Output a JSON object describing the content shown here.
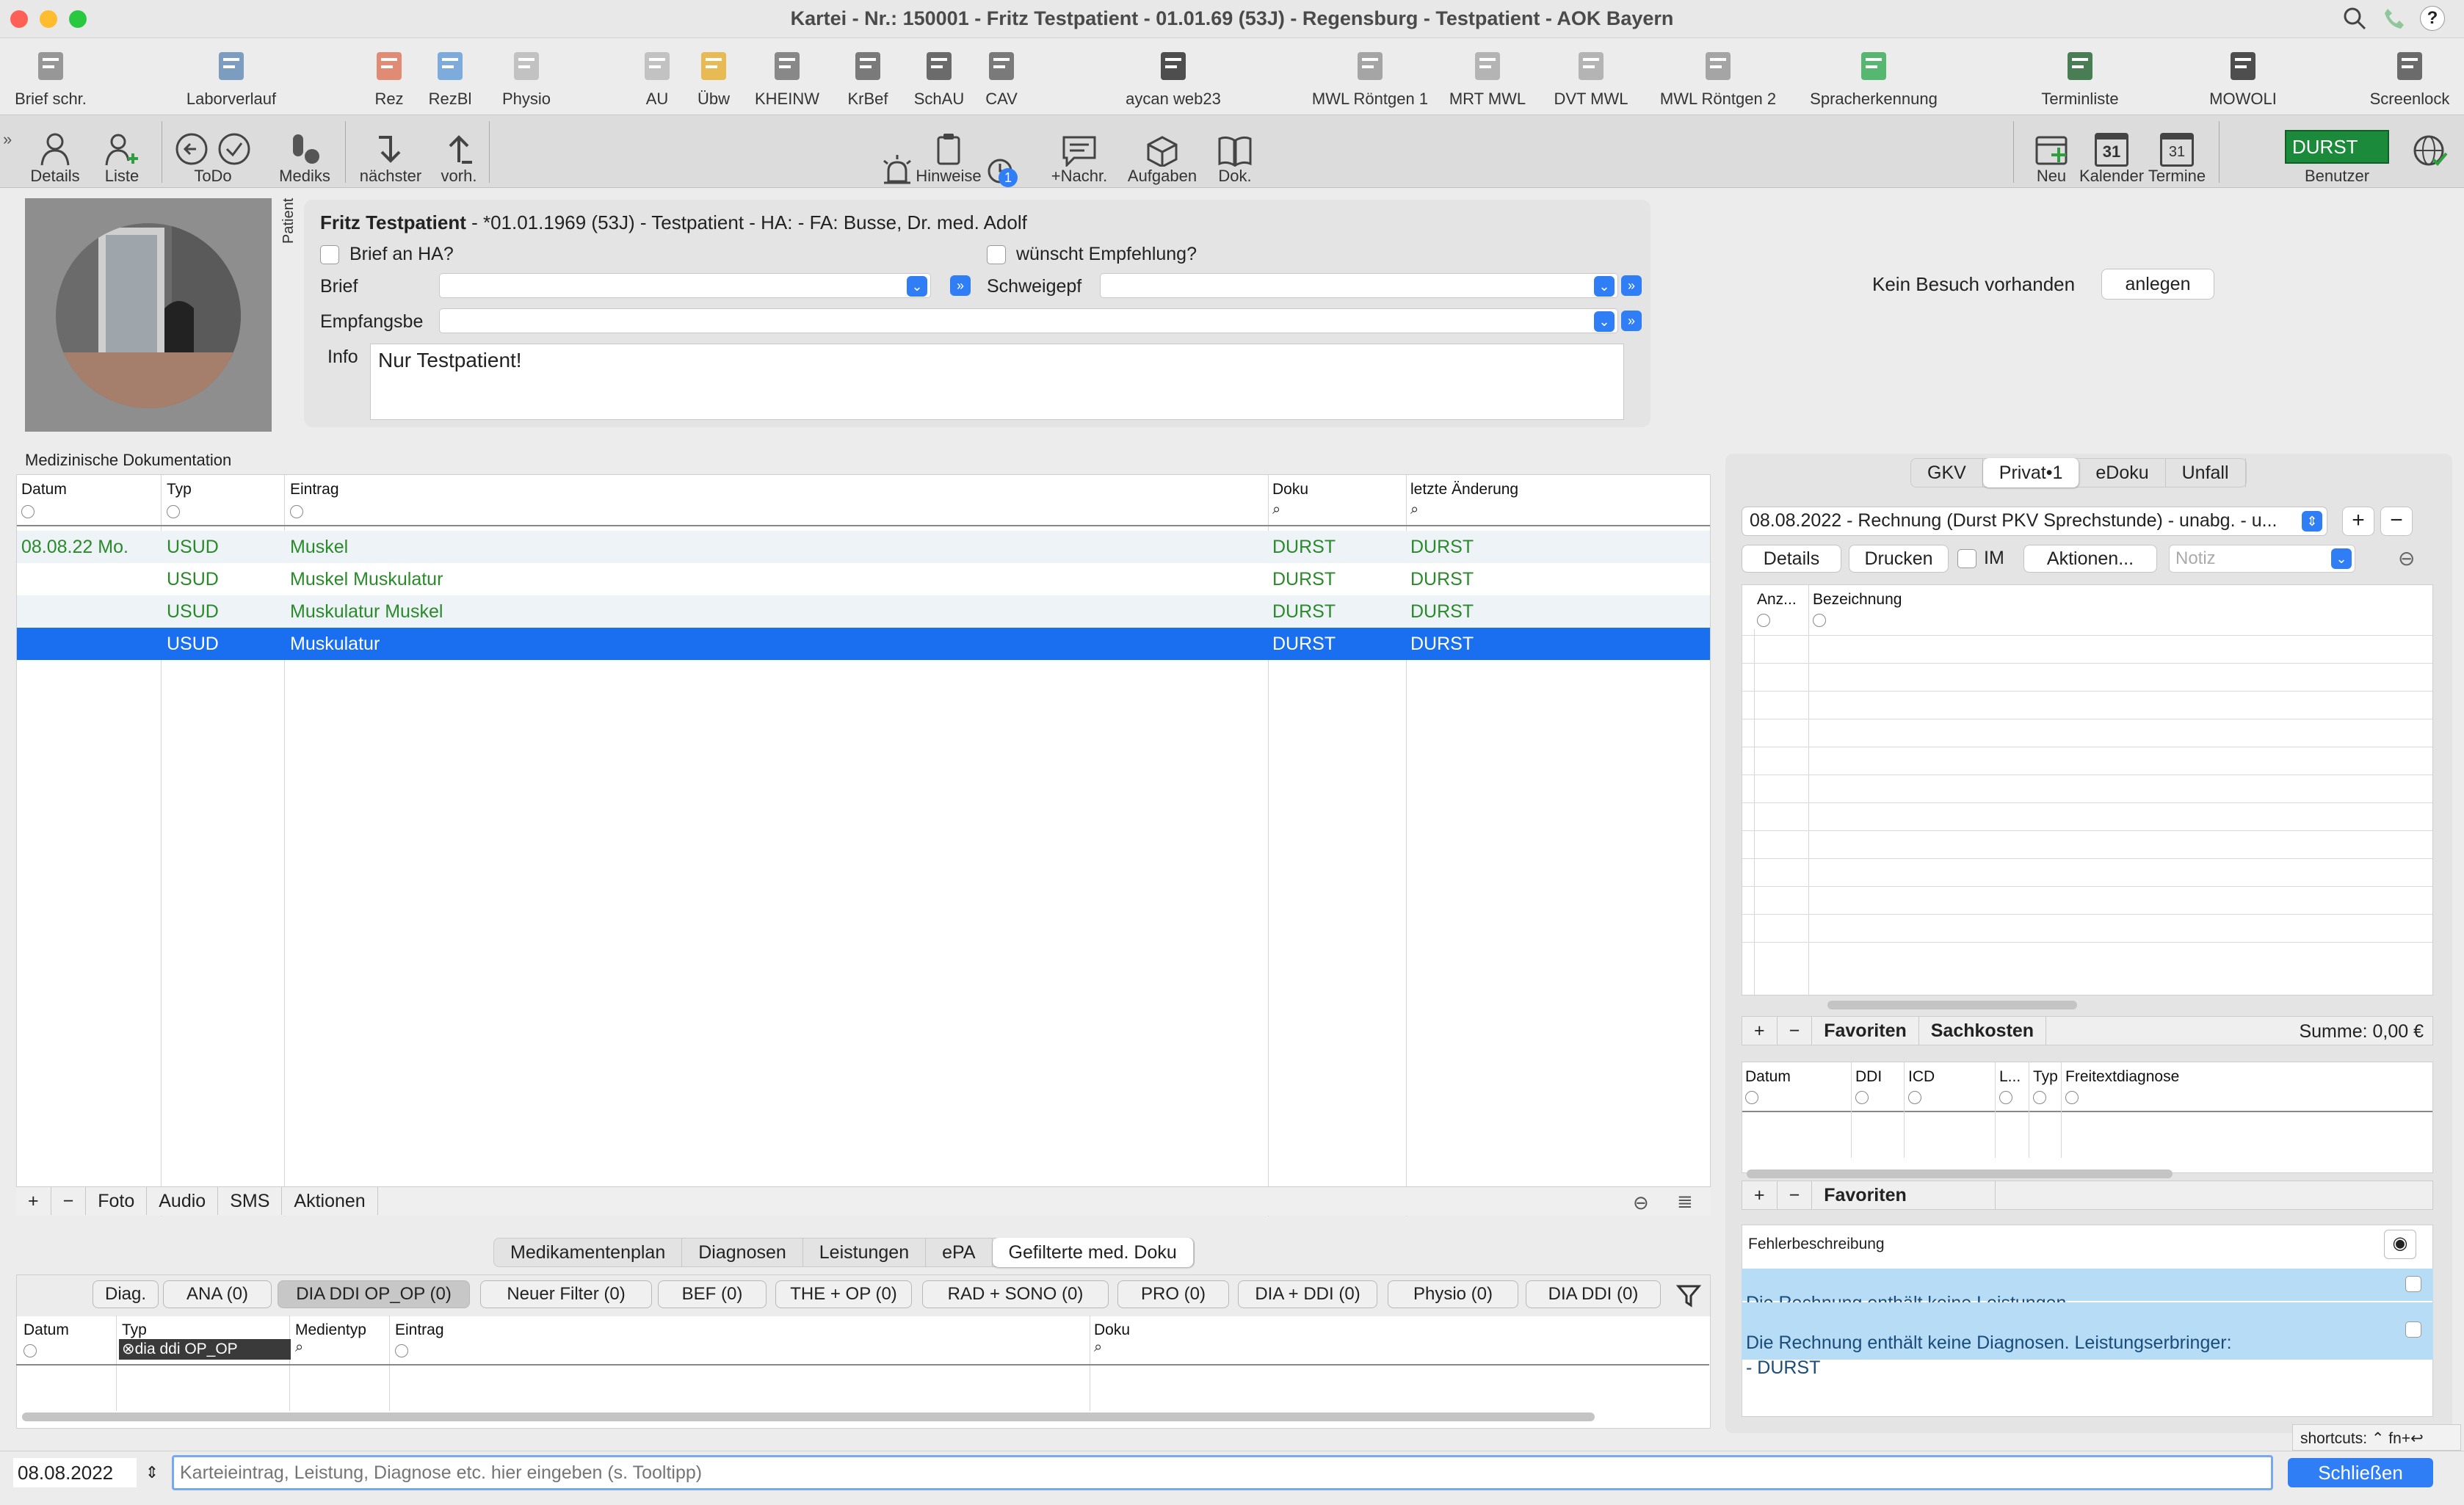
{
  "window": {
    "title": "Kartei - Nr.: 150001 - Fritz Testpatient - 01.01.69 (53J) - Regensburg - Testpatient - AOK Bayern"
  },
  "toolbar1": [
    {
      "label": "Brief schr.",
      "icon": "letter-write-icon"
    },
    {
      "label": "Laborverlauf",
      "icon": "lab-flask-icon"
    },
    {
      "label": "Rez",
      "icon": "prescription-icon"
    },
    {
      "label": "RezBl",
      "icon": "prescription-blue-icon"
    },
    {
      "label": "Physio",
      "icon": "physio-form-icon"
    },
    {
      "label": "AU",
      "icon": "au-form-icon"
    },
    {
      "label": "Übw",
      "icon": "referral-icon"
    },
    {
      "label": "KHEINW",
      "icon": "hospital-icon"
    },
    {
      "label": "KrBef",
      "icon": "ambulance-icon"
    },
    {
      "label": "SchAU",
      "icon": "school-form-icon"
    },
    {
      "label": "CAV",
      "icon": "cav-icon"
    },
    {
      "label": "aycan web23",
      "icon": "aycan-web-icon"
    },
    {
      "label": "MWL Röntgen 1",
      "icon": "xray-device-icon"
    },
    {
      "label": "MRT MWL",
      "icon": "mrt-device-icon"
    },
    {
      "label": "DVT MWL",
      "icon": "dvt-device-icon"
    },
    {
      "label": "MWL Röntgen 2",
      "icon": "xray-device-2-icon"
    },
    {
      "label": "Spracherkennung",
      "icon": "microphone-icon"
    },
    {
      "label": "Terminliste",
      "icon": "appointment-list-icon"
    },
    {
      "label": "MOWOLI",
      "icon": "mowoli-icon"
    },
    {
      "label": "Screenlock",
      "icon": "screenlock-icon"
    }
  ],
  "toolbar2": {
    "details": "Details",
    "liste": "Liste",
    "todo": "ToDo",
    "mediks": "Mediks",
    "naechster": "nächster",
    "vorh": "vorh.",
    "hinweise": "Hinweise",
    "hinweise_badge": "1",
    "nachr": "+Nachr.",
    "aufgaben": "Aufgaben",
    "dok": "Dok.",
    "neu": "Neu",
    "kalender": "Kalender",
    "kalender_day": "31",
    "termine": "Termine",
    "termine_day": "31",
    "user_badge": "DURST",
    "benutzer": "Benutzer"
  },
  "patient": {
    "tab_label": "Patient",
    "name": "Fritz Testpatient",
    "header_rest": " - *01.01.1969 (53J) - Testpatient - HA:  - FA: Busse, Dr. med. Adolf",
    "brief_an_ha": "Brief an HA?",
    "empfehlung": "wünscht Empfehlung?",
    "brief_label": "Brief",
    "schweigepf_label": "Schweigepf",
    "empfangsbe_label": "Empfangsbe",
    "info_label": "Info",
    "info_text": "Nur Testpatient!"
  },
  "visit": {
    "text": "Kein Besuch vorhanden",
    "button": "anlegen"
  },
  "med_doku": {
    "title": "Medizinische Dokumentation",
    "columns": [
      "Datum",
      "Typ",
      "Eintrag",
      "Doku",
      "letzte Änderung"
    ],
    "rows": [
      {
        "datum": "08.08.22  Mo.",
        "typ": "USUD",
        "eintrag": "Muskel",
        "doku": "DURST",
        "aenderung": "DURST"
      },
      {
        "datum": "",
        "typ": "USUD",
        "eintrag": "Muskel Muskulatur",
        "doku": "DURST",
        "aenderung": "DURST"
      },
      {
        "datum": "",
        "typ": "USUD",
        "eintrag": "Muskulatur Muskel",
        "doku": "DURST",
        "aenderung": "DURST"
      },
      {
        "datum": "",
        "typ": "USUD",
        "eintrag": "Muskulatur",
        "doku": "DURST",
        "aenderung": "DURST"
      }
    ],
    "bottom_buttons": [
      "+",
      "−",
      "Foto",
      "Audio",
      "SMS",
      "Aktionen"
    ]
  },
  "lower_tabs": [
    "Medikamentenplan",
    "Diagnosen",
    "Leistungen",
    "ePA",
    "Gefilterte med. Doku"
  ],
  "filters": [
    "Diag.",
    "ANA (0)",
    "DIA DDI OP_OP (0)",
    "Neuer Filter (0)",
    "BEF (0)",
    "THE + OP (0)",
    "RAD + SONO (0)",
    "PRO (0)",
    "DIA + DDI (0)",
    "Physio (0)",
    "DIA DDI (0)"
  ],
  "filtered_table": {
    "columns": [
      "Datum",
      "Typ",
      "Medientyp",
      "Eintrag",
      "Doku"
    ],
    "typ_filter": "dia ddi OP_OP"
  },
  "billing": {
    "tabs": [
      "GKV",
      "Privat•1",
      "eDoku",
      "Unfall"
    ],
    "invoice": "08.08.2022 - Rechnung (Durst PKV Sprechstunde) - unabg. - u...",
    "details": "Details",
    "drucken": "Drucken",
    "im": "IM",
    "aktionen": "Aktionen...",
    "notiz_placeholder": "Notiz",
    "columns": [
      "Anz...",
      "Bezeichnung"
    ],
    "favoriten": "Favoriten",
    "sachkosten": "Sachkosten",
    "summe": "Summe: 0,00 €",
    "diag_columns": [
      "Datum",
      "DDI",
      "ICD",
      "L...",
      "Typ",
      "Freitextdiagnose"
    ],
    "favoriten2": "Favoriten",
    "fehler_title": "Fehlerbeschreibung",
    "errors": [
      "Die Rechnung enthält keine Leistungen.",
      "Die Rechnung enthält keine Diagnosen. Leistungserbringer:\n- DURST"
    ]
  },
  "shortcuts": "shortcuts: ⌃  fn+↩",
  "footer": {
    "date": "08.08.2022",
    "input_placeholder": "Karteieintrag, Leistung, Diagnose etc. hier eingeben (s. Tooltipp)",
    "close": "Schließen"
  },
  "colors": {
    "selection": "#1a6ff0",
    "green_text": "#2a8a2a",
    "accent": "#2f7ef5",
    "user_badge": "#1b8a3a",
    "error_bg": "#b7dcf5"
  }
}
